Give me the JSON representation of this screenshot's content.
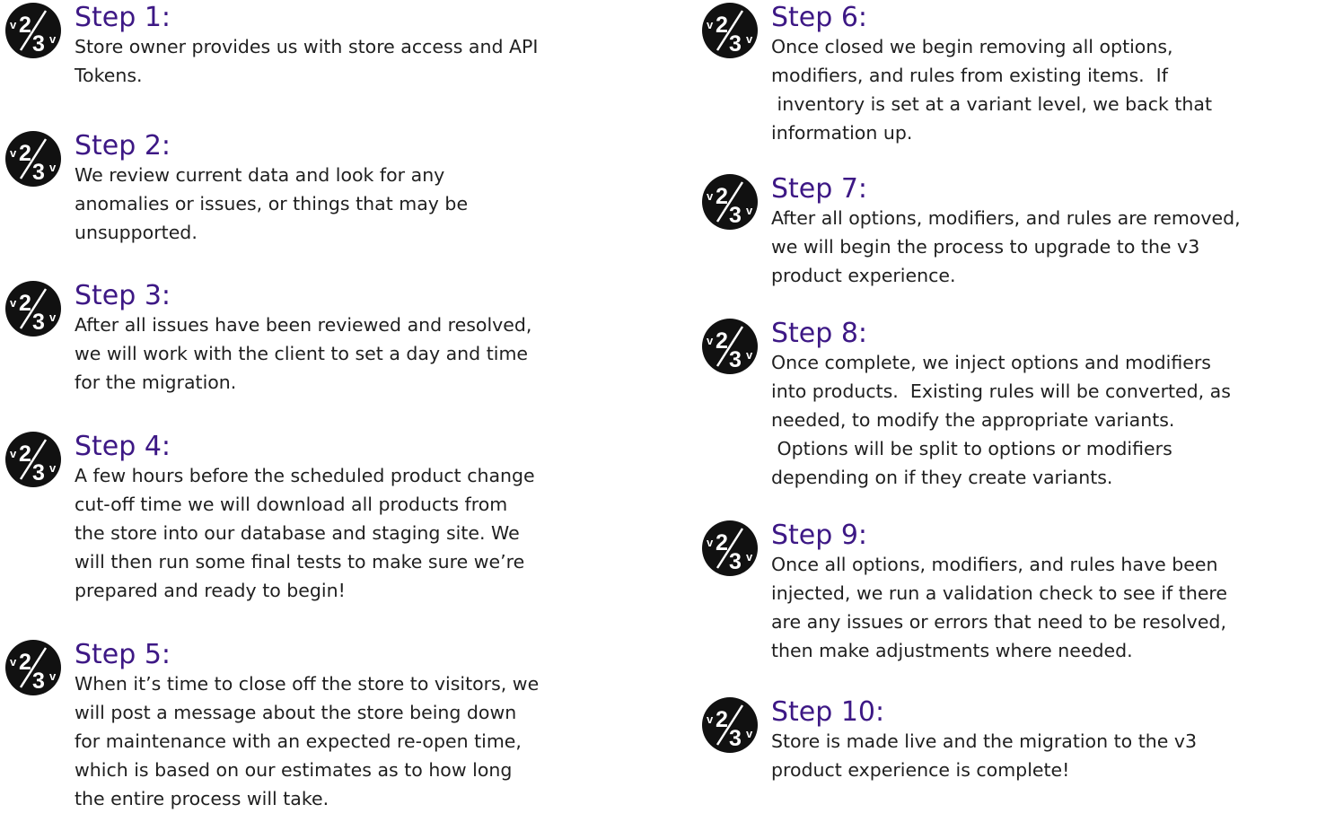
{
  "steps": [
    {
      "title": "Step 1:",
      "description": "Store owner provides us with store access and API\nTokens."
    },
    {
      "title": "Step 2:",
      "description": "We review current data and look for any\nanomalies or issues, or things that may be\nunsupported."
    },
    {
      "title": "Step 3:",
      "description": "After all issues have been reviewed and resolved,\nwe will work with the client to set a day and time\nfor the migration."
    },
    {
      "title": "Step 4:",
      "description": "A few hours before the scheduled product change\ncut-off time we will download all products from\nthe store into our database and staging site. We\nwill then run some final tests to make sure we’re\nprepared and ready to begin!"
    },
    {
      "title": "Step 5:",
      "description": "When it’s time to close off the store to visitors, we\nwill post a message about the store being down\nfor maintenance with an expected re-open time,\nwhich is based on our estimates as to how long\nthe entire process will take."
    },
    {
      "title": "Step 6:",
      "description": "Once closed we begin removing all options,\nmodifiers, and rules from existing items.  If\n inventory is set at a variant level, we back that\ninformation up."
    },
    {
      "title": "Step 7:",
      "description": "After all options, modifiers, and rules are removed,\nwe will begin the process to upgrade to the v3\nproduct experience."
    },
    {
      "title": "Step 8:",
      "description": "Once complete, we inject options and modifiers\ninto products.  Existing rules will be converted, as\nneeded, to modify the appropriate variants.\n Options will be split to options or modifiers\ndepending on if they create variants."
    },
    {
      "title": "Step 9:",
      "description": "Once all options, modifiers, and rules have been\ninjected, we run a validation check to see if there\nare any issues or errors that need to be resolved,\nthen make adjustments where needed."
    },
    {
      "title": "Step 10:",
      "description": "Store is made live and the migration to the v3\nproduct experience is complete!"
    }
  ],
  "badge": {
    "icon": "v2-to-v3-icon",
    "small_left": "v",
    "big_top": "2",
    "big_bottom": "3",
    "small_right": "v",
    "color": "#111111"
  },
  "colors": {
    "title": "#3d1885",
    "body": "#1f1f1f",
    "background": "#ffffff"
  }
}
